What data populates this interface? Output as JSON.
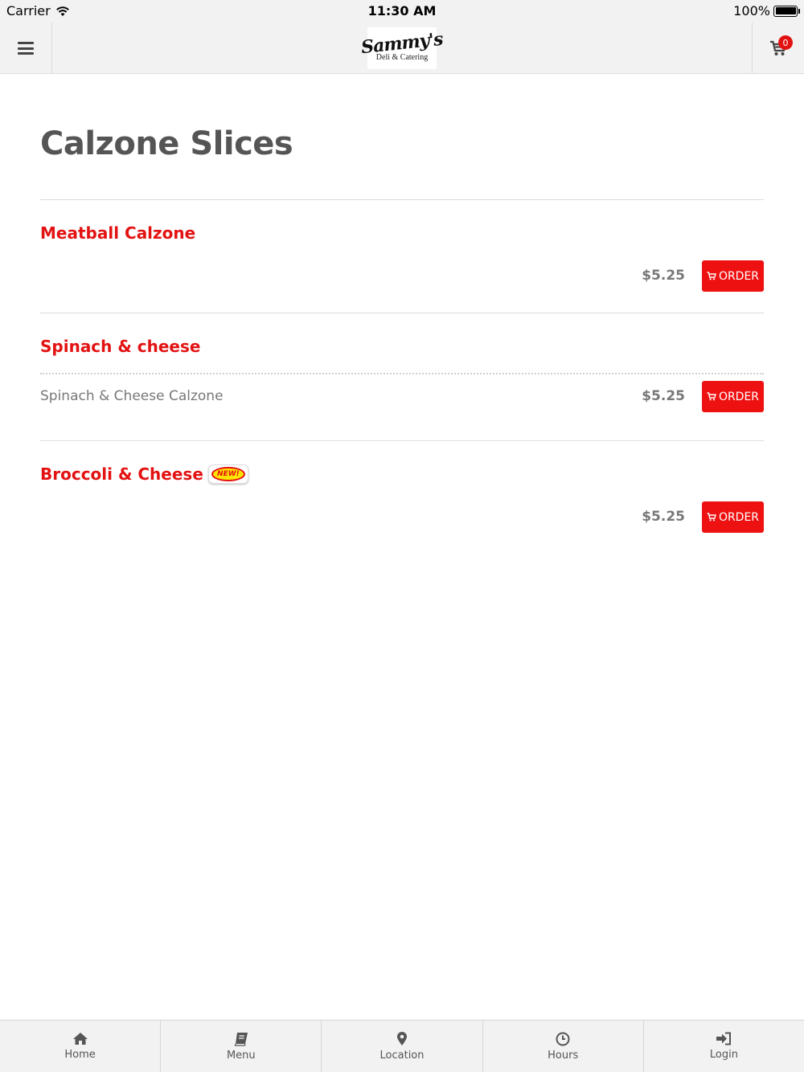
{
  "status_bar": {
    "carrier": "Carrier",
    "time": "11:30 AM",
    "battery": "100%"
  },
  "header": {
    "logo_main": "Sammy's",
    "logo_sub": "Deli & Catering",
    "cart_count": "0"
  },
  "page": {
    "title": "Calzone Slices"
  },
  "items": [
    {
      "name": "Meatball Calzone",
      "description": "",
      "price": "$5.25",
      "order_label": "ORDER",
      "is_new": false
    },
    {
      "name": "Spinach & cheese",
      "description": "Spinach & Cheese Calzone",
      "price": "$5.25",
      "order_label": "ORDER",
      "is_new": false
    },
    {
      "name": "Broccoli & Cheese",
      "description": "",
      "price": "$5.25",
      "order_label": "ORDER",
      "is_new": true,
      "new_badge": "NEW!"
    }
  ],
  "tabbar": {
    "tabs": [
      {
        "label": "Home",
        "icon": "home-icon"
      },
      {
        "label": "Menu",
        "icon": "book-icon"
      },
      {
        "label": "Location",
        "icon": "map-pin-icon"
      },
      {
        "label": "Hours",
        "icon": "clock-icon"
      },
      {
        "label": "Login",
        "icon": "sign-in-icon"
      }
    ]
  },
  "colors": {
    "accent": "#ee1111",
    "item_name": "#e31212",
    "bar_bg": "#f2f2f2"
  }
}
